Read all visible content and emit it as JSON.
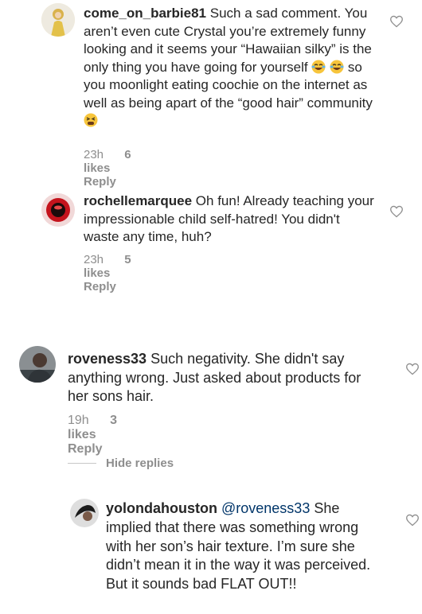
{
  "comments": [
    {
      "username": "come_on_barbie81",
      "text_1": "Such a sad comment. You aren’t even cute Crystal you’re extremely funny looking and it seems your “Hawaiian silky” is the only thing you have going for yourself",
      "text_2": "so you moonlight eating coochie on the internet as well as being apart of the “good hair” community",
      "time": "23h",
      "likes": "6 likes",
      "reply": "Reply",
      "emoji_1": "face-with-tears-of-joy-icon",
      "emoji_2": "tired-face-icon"
    },
    {
      "username": "rochellemarquee",
      "text": "Oh fun! Already teaching your impressionable child self-hatred! You didn't waste any time, huh?",
      "time": "23h",
      "likes": "5 likes",
      "reply": "Reply"
    },
    {
      "username": "roveness33",
      "text": "Such negativity. She didn't say anything wrong. Just asked about products for her sons hair.",
      "time": "19h",
      "likes": "3 likes",
      "reply": "Reply"
    },
    {
      "username": "yolondahouston",
      "mention": "@roveness33",
      "text": "She implied that there was something wrong with her son’s hair texture. I’m sure she didn’t mean it in the way it was perceived. But it sounds bad FLAT OUT!!"
    }
  ],
  "hide_replies": "Hide replies",
  "colors": {
    "meta": "#8e8e8e",
    "mention": "#003569",
    "text": "#262626"
  }
}
